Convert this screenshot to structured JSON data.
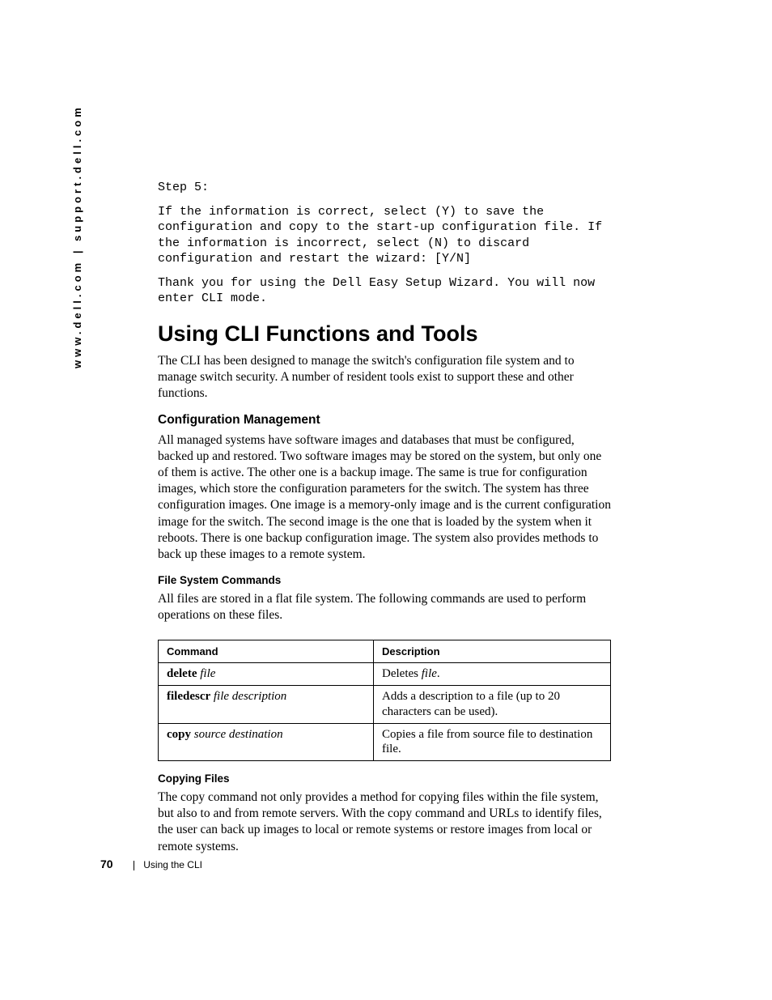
{
  "side_url": "www.dell.com | support.dell.com",
  "step5": {
    "label": "Step 5:",
    "para1": "If the information is correct, select (Y) to save the configuration and copy to the start-up configuration file. If the information is incorrect, select (N) to discard configuration and restart the wizard: [Y/N]",
    "para2": "Thank you for using the Dell Easy Setup Wizard. You will now enter CLI mode."
  },
  "heading_main": "Using CLI Functions and Tools",
  "intro": "The CLI has been designed to manage the switch's configuration file system and to manage switch security. A number of resident tools exist to support these and other functions.",
  "heading_config": "Configuration Management",
  "config_para": "All managed systems have software images and databases that must be configured, backed up and restored. Two software images may be stored on the system, but only one of them is active. The other one is a backup image. The same is true for configuration images, which store the configuration parameters for the switch. The system has three configuration images. One image is a memory-only image and is the current configuration image for the switch. The second image is the one that is loaded by the system when it reboots. There is one backup configuration image. The system also provides methods to back up these images to a remote system.",
  "heading_fsc": "File System Commands",
  "fsc_para": "All files are stored in a flat file system. The following commands are used to perform operations on these files.",
  "table": {
    "head_cmd": "Command",
    "head_desc": "Description",
    "rows": [
      {
        "cmd_bold": "delete",
        "cmd_ital": "file",
        "desc_pre": "Deletes ",
        "desc_ital": "file",
        "desc_post": "."
      },
      {
        "cmd_bold": "filedescr",
        "cmd_ital": "file description",
        "desc_pre": "Adds a description to a file (up to 20 characters can be used).",
        "desc_ital": "",
        "desc_post": ""
      },
      {
        "cmd_bold": "copy",
        "cmd_ital": "source destination",
        "desc_pre": "Copies a file from source file to destination file.",
        "desc_ital": "",
        "desc_post": ""
      }
    ]
  },
  "heading_copy": "Copying Files",
  "copy_para": "The copy command not only provides a method for copying files within the file system, but also to and from remote servers. With the copy command and URLs to identify files, the user can back up images to local or remote systems or restore images from local or remote systems.",
  "footer": {
    "page": "70",
    "section": "Using the CLI"
  }
}
